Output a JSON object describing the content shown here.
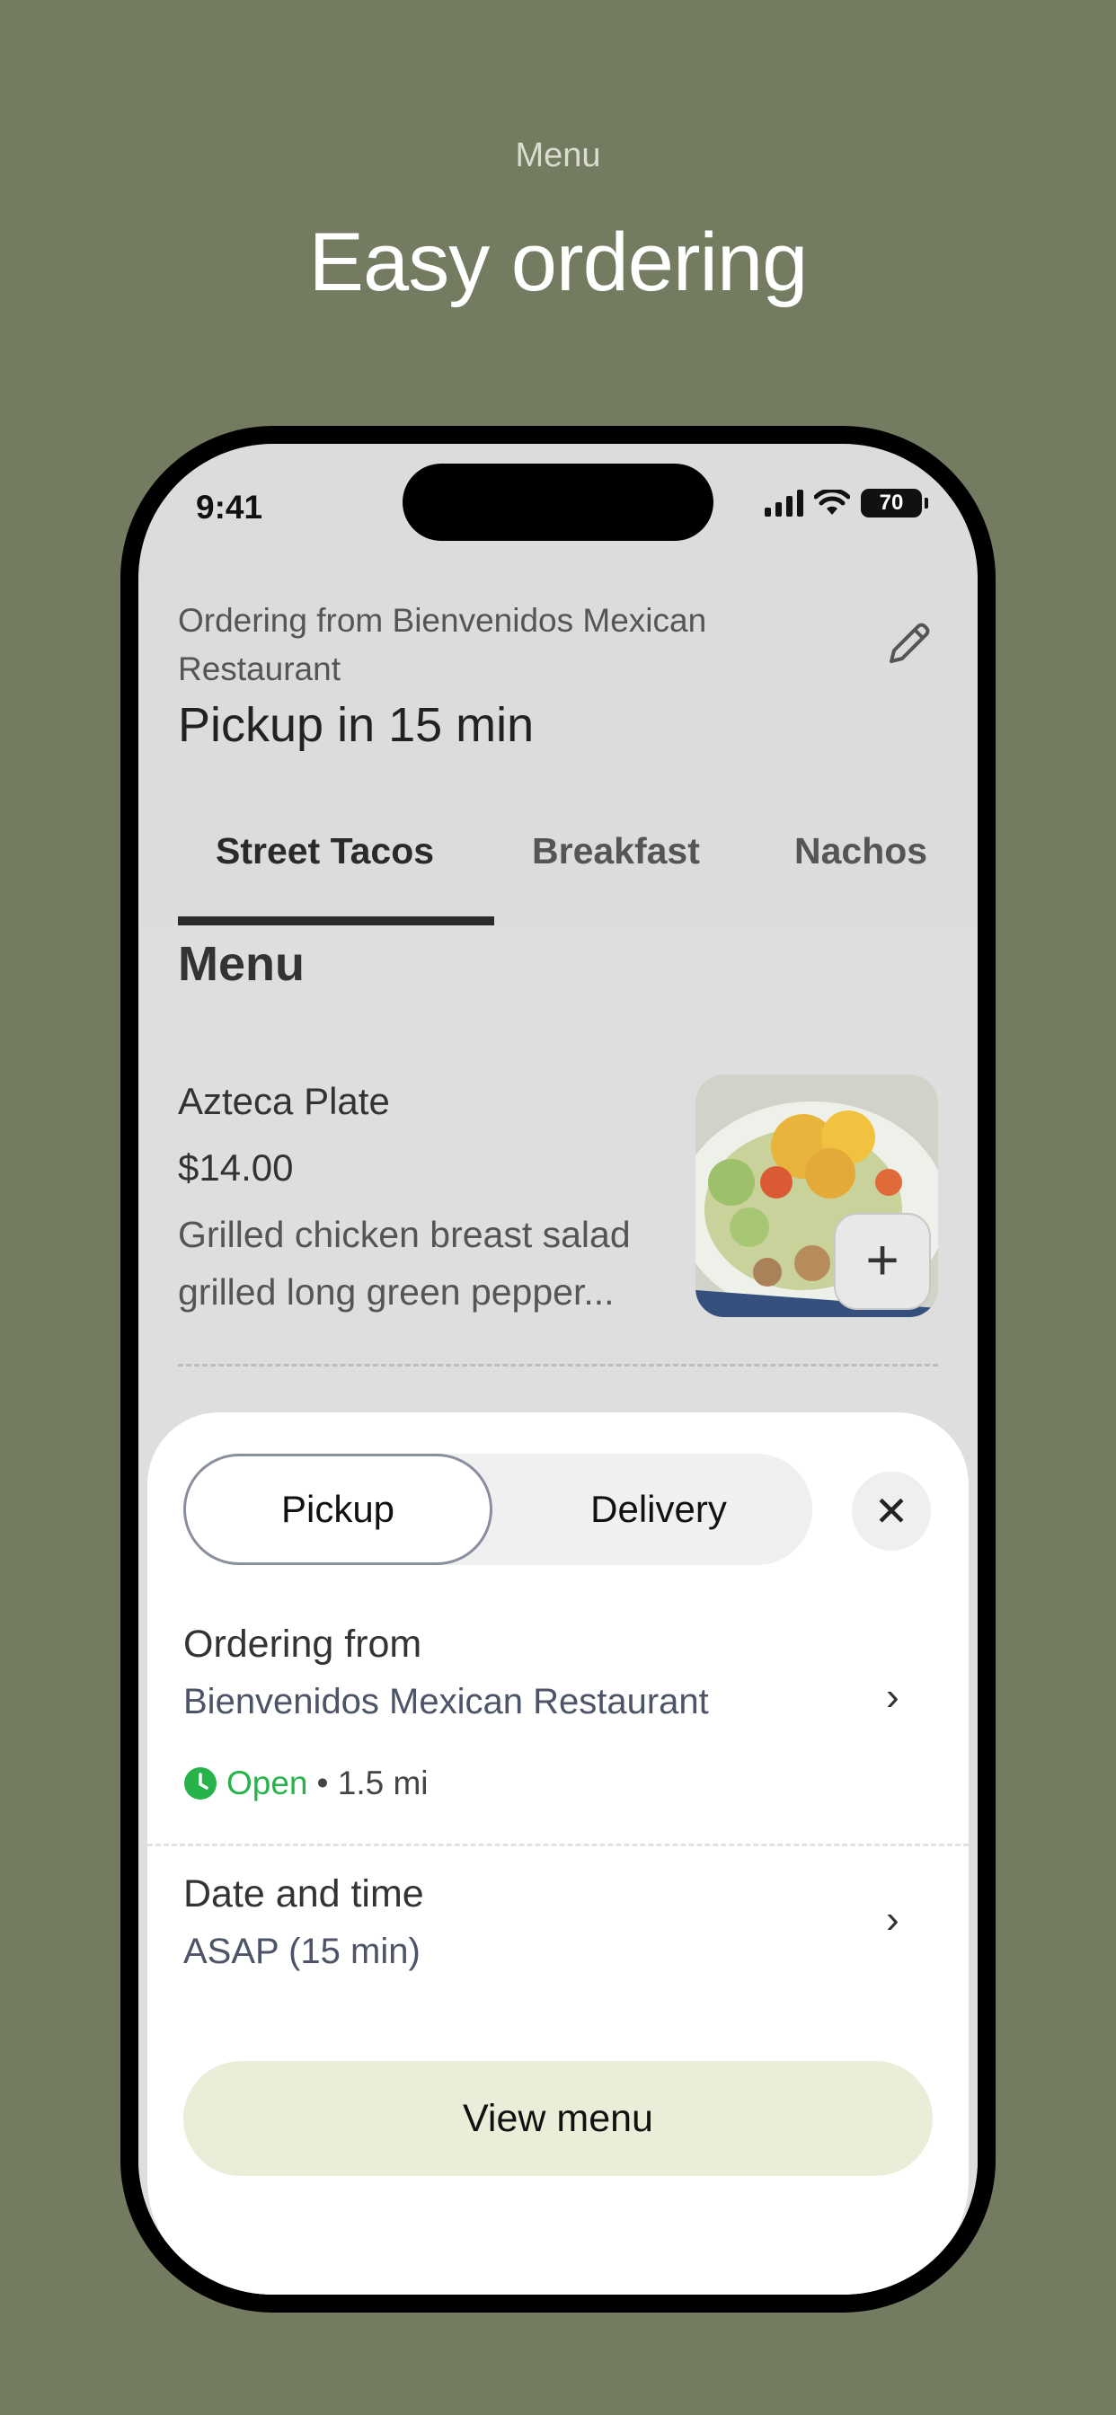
{
  "promo": {
    "eyebrow": "Menu",
    "title": "Easy ordering"
  },
  "status_bar": {
    "time": "9:41",
    "battery": "70",
    "icons": [
      "signal-icon",
      "wifi-icon",
      "battery-icon"
    ]
  },
  "header": {
    "ordering_line": "Ordering from Bienvenidos Mexican Restaurant",
    "pickup_title": "Pickup in 15 min",
    "edit_icon": "pencil-icon"
  },
  "tabs": [
    {
      "label": "Street Tacos",
      "active": true
    },
    {
      "label": "Breakfast",
      "active": false
    },
    {
      "label": "Nachos",
      "active": false
    }
  ],
  "menu": {
    "heading": "Menu",
    "items": [
      {
        "name": "Azteca Plate",
        "price": "$14.00",
        "description": "Grilled chicken breast salad grilled long green pepper...",
        "add_label": "+"
      }
    ]
  },
  "sheet": {
    "mode_options": [
      {
        "label": "Pickup",
        "selected": true
      },
      {
        "label": "Delivery",
        "selected": false
      }
    ],
    "close_label": "✕",
    "ordering_from": {
      "label": "Ordering from",
      "value": "Bienvenidos Mexican Restaurant",
      "status": "Open",
      "distance": "• 1.5 mi"
    },
    "date_time": {
      "label": "Date and time",
      "value": "ASAP (15 min)"
    },
    "view_menu_label": "View menu"
  },
  "colors": {
    "background": "#737b60",
    "open_status": "#27b24a",
    "primary_button": "#e9eed9",
    "tab_indicator": "#2b2b2b"
  }
}
